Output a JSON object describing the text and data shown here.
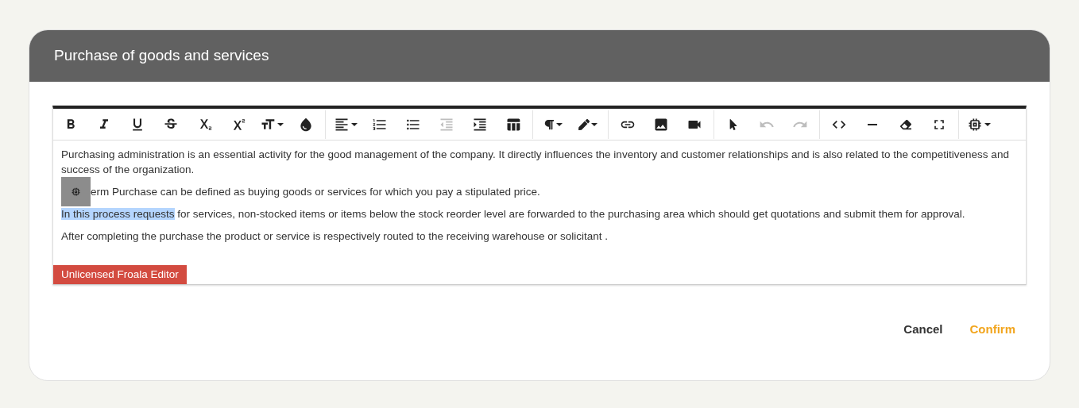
{
  "dialog": {
    "title": "Purchase of goods and services"
  },
  "toolbar": {
    "groups": [
      [
        {
          "kind": "bold",
          "disabled": false,
          "dropdown": false
        },
        {
          "kind": "italic",
          "disabled": false,
          "dropdown": false
        },
        {
          "kind": "underline",
          "disabled": false,
          "dropdown": false
        },
        {
          "kind": "strike",
          "disabled": false,
          "dropdown": false
        },
        {
          "kind": "subscript",
          "disabled": false,
          "dropdown": false
        },
        {
          "kind": "superscript",
          "disabled": false,
          "dropdown": false
        },
        {
          "kind": "font-size",
          "disabled": false,
          "dropdown": true
        },
        {
          "kind": "color",
          "disabled": false,
          "dropdown": false
        }
      ],
      [
        {
          "kind": "align",
          "disabled": false,
          "dropdown": true
        },
        {
          "kind": "ordered-list",
          "disabled": false,
          "dropdown": false
        },
        {
          "kind": "bullet-list",
          "disabled": false,
          "dropdown": false
        },
        {
          "kind": "outdent",
          "disabled": true,
          "dropdown": false
        },
        {
          "kind": "indent",
          "disabled": false,
          "dropdown": false
        },
        {
          "kind": "table",
          "disabled": false,
          "dropdown": false
        }
      ],
      [
        {
          "kind": "paragraph",
          "disabled": false,
          "dropdown": true
        },
        {
          "kind": "pen",
          "disabled": false,
          "dropdown": true
        }
      ],
      [
        {
          "kind": "link",
          "disabled": false,
          "dropdown": false
        },
        {
          "kind": "image",
          "disabled": false,
          "dropdown": false
        },
        {
          "kind": "video",
          "disabled": false,
          "dropdown": false
        }
      ],
      [
        {
          "kind": "pointer",
          "disabled": false,
          "dropdown": false
        },
        {
          "kind": "undo",
          "disabled": true,
          "dropdown": false
        },
        {
          "kind": "redo",
          "disabled": true,
          "dropdown": false
        }
      ],
      [
        {
          "kind": "code",
          "disabled": false,
          "dropdown": false
        },
        {
          "kind": "rule",
          "disabled": false,
          "dropdown": false
        },
        {
          "kind": "eraser",
          "disabled": false,
          "dropdown": false
        },
        {
          "kind": "fullscreen",
          "disabled": false,
          "dropdown": false
        }
      ],
      [
        {
          "kind": "ai",
          "disabled": false,
          "dropdown": true
        }
      ]
    ]
  },
  "paragraphs": [
    {
      "ai_popup": false,
      "segments": [
        {
          "text": "Purchasing administration is an essential activity for the good management of the company. It directly influences the inventory and customer relationships and is also related to the competitiveness and success of the organization.",
          "selected": false
        }
      ]
    },
    {
      "ai_popup": true,
      "segments": [
        {
          "text": "erm Purchase can be defined as buying goods or services for which you pay a stipulated price.",
          "selected": false
        }
      ]
    },
    {
      "ai_popup": false,
      "segments": [
        {
          "text": "In this process requests",
          "selected": true
        },
        {
          "text": " for services, non-stocked items or items below the stock reorder level are forwarded to the purchasing area which should get quotations and submit them for approval.",
          "selected": false
        }
      ]
    },
    {
      "ai_popup": false,
      "segments": [
        {
          "text": "After completing the purchase the product or service is respectively routed to the receiving warehouse or solicitant .",
          "selected": false
        }
      ]
    }
  ],
  "license_banner": "Unlicensed Froala Editor",
  "buttons": [
    {
      "label": "Cancel",
      "kind": "secondary"
    },
    {
      "label": "Confirm",
      "kind": "primary"
    }
  ]
}
